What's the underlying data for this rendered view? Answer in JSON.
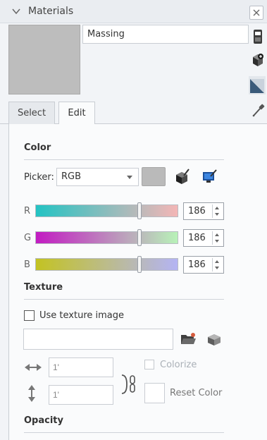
{
  "window": {
    "title": "Materials"
  },
  "material": {
    "name": "Massing",
    "preview_color": "#bdbdbd"
  },
  "tabs": [
    {
      "label": "Select"
    },
    {
      "label": "Edit"
    }
  ],
  "active_tab": "Edit",
  "color": {
    "section_label": "Color",
    "picker_label": "Picker:",
    "picker_value": "RGB",
    "swatch_color": "#bababa",
    "channels": [
      {
        "label": "R",
        "value": "186",
        "level": 0.73
      },
      {
        "label": "G",
        "value": "186",
        "level": 0.73
      },
      {
        "label": "B",
        "value": "186",
        "level": 0.73
      }
    ]
  },
  "texture": {
    "section_label": "Texture",
    "use_texture_label": "Use texture image",
    "use_texture_checked": false,
    "path_value": "",
    "width_value": "1'",
    "height_value": "1'",
    "colorize_label": "Colorize",
    "reset_color_label": "Reset Color"
  },
  "opacity": {
    "section_label": "Opacity"
  },
  "icons": {
    "collapse": "chevron-down-icon",
    "close": "close-icon",
    "secondary": "material-secondary-icon",
    "create": "create-material-icon",
    "default": "default-material-triangle-icon",
    "sample": "eyedropper-icon",
    "match_model": "match-model-color-icon",
    "match_screen": "match-screen-color-icon",
    "browse": "folder-open-icon",
    "edit_texture": "edit-texture-icon",
    "width": "horizontal-arrows-icon",
    "height": "vertical-arrows-icon",
    "aspect_lock": "chain-link-icon"
  }
}
